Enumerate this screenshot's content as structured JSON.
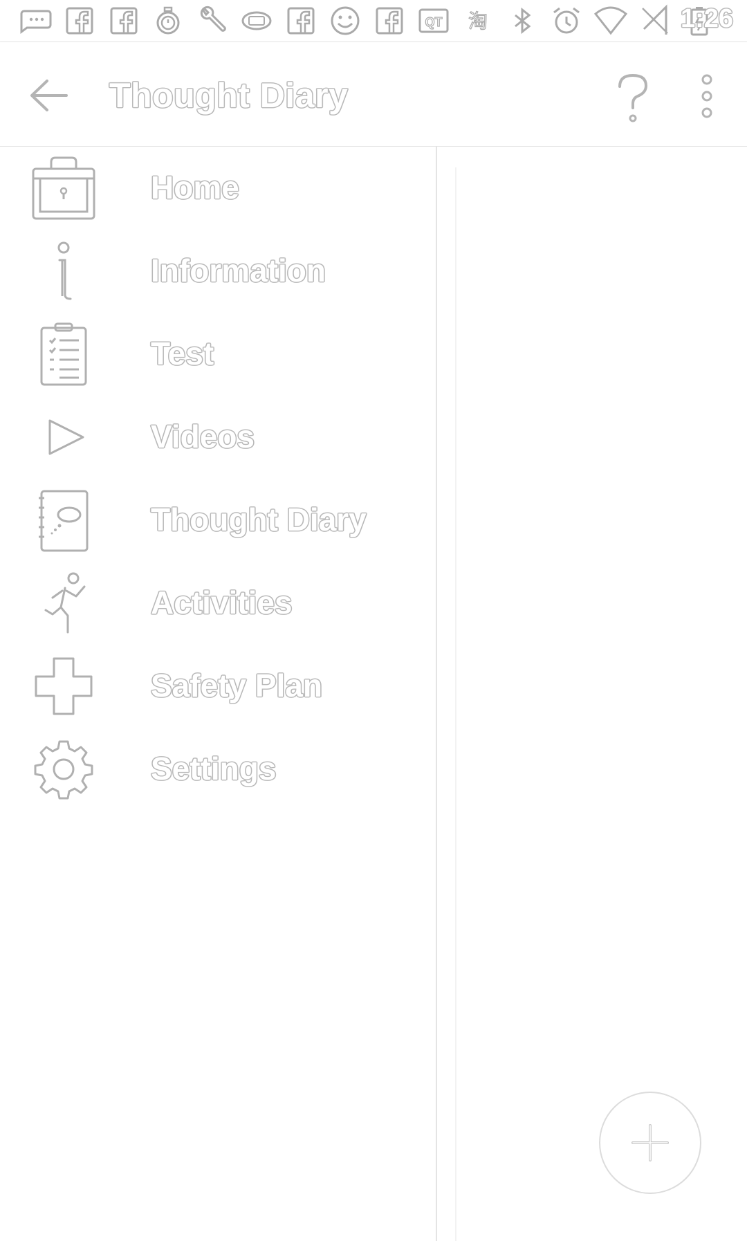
{
  "status_bar": {
    "time": "1:26",
    "icons": [
      "chat-bubble-icon",
      "facebook-icon",
      "facebook-icon",
      "stopwatch-icon",
      "wrench-icon",
      "scanner-icon",
      "facebook-icon",
      "smiley-icon",
      "facebook-icon",
      "qt-icon",
      "taobao-icon",
      "bluetooth-icon",
      "alarm-icon",
      "wifi-icon",
      "no-sim-icon",
      "battery-charging-icon"
    ],
    "qt_text": "QT",
    "taobao_text": "淘"
  },
  "toolbar": {
    "title": "Thought Diary",
    "back_icon": "arrow-left-icon",
    "help_icon": "question-mark-icon",
    "more_icon": "more-vert-icon"
  },
  "drawer": {
    "items": [
      {
        "label": "Home",
        "icon": "locked-box-icon"
      },
      {
        "label": "Information",
        "icon": "info-icon"
      },
      {
        "label": "Test",
        "icon": "clipboard-icon"
      },
      {
        "label": "Videos",
        "icon": "play-icon"
      },
      {
        "label": "Thought Diary",
        "icon": "notebook-icon"
      },
      {
        "label": "Activities",
        "icon": "running-person-icon"
      },
      {
        "label": "Safety Plan",
        "icon": "cross-icon"
      },
      {
        "label": "Settings",
        "icon": "gear-icon"
      }
    ]
  },
  "fab": {
    "icon": "plus-icon"
  }
}
